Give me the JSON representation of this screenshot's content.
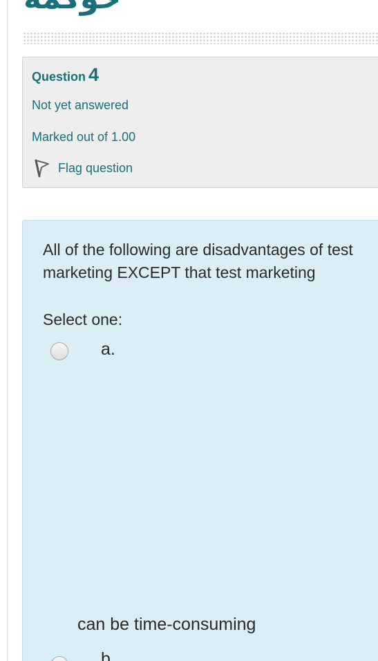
{
  "header": {
    "section_title": "حوكمة"
  },
  "question_info": {
    "label": "Question",
    "number": "4",
    "state": "Not yet answered",
    "grade": "Marked out of 1.00",
    "flag_label": "Flag question"
  },
  "question": {
    "text": "All of the following are disadvantages of test marketing EXCEPT that test marketing",
    "prompt": "Select one:",
    "options": [
      {
        "letter": "a.",
        "text": "can be time-consuming"
      },
      {
        "letter": "b.",
        "text": ""
      }
    ]
  },
  "colors": {
    "accent": "#1b6f7a",
    "info_bg": "#eeeeee",
    "content_bg": "#dbeef5"
  },
  "icons": {
    "flag": "flag-outline-icon"
  }
}
